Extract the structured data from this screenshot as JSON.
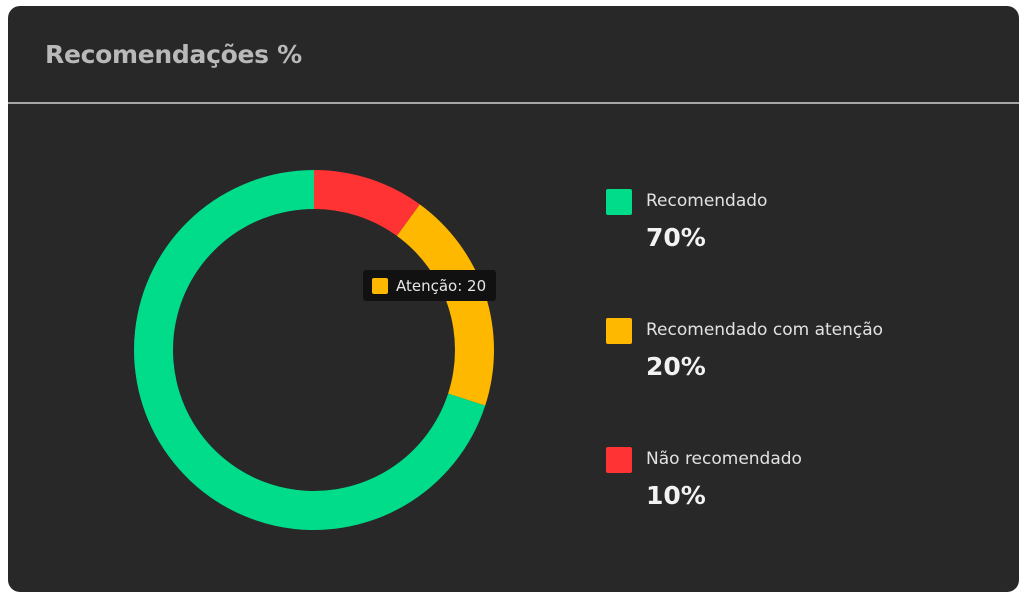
{
  "header": {
    "title": "Recomendações %"
  },
  "colors": {
    "card_background": "#282828",
    "title": "#b9b9b9",
    "divider": "#a6a6a6"
  },
  "chart_data": {
    "type": "pie",
    "variant": "donut",
    "title": "Recomendações %",
    "slices": [
      {
        "label": "Não recomendado",
        "value": 10,
        "display": "10%",
        "color": "#ff3333"
      },
      {
        "label": "Recomendado com atenção",
        "value": 20,
        "display": "20%",
        "color": "#ffb800"
      },
      {
        "label": "Recomendado",
        "value": 70,
        "display": "70%",
        "color": "#00dc8a"
      }
    ],
    "legend": {
      "placement": "right",
      "items": [
        {
          "label": "Recomendado",
          "display": "70%",
          "color": "#00dc8a"
        },
        {
          "label": "Recomendado com atenção",
          "display": "20%",
          "color": "#ffb800"
        },
        {
          "label": "Não recomendado",
          "display": "10%",
          "color": "#ff3333"
        }
      ]
    },
    "tooltip": {
      "text": "Atenção: 20",
      "color": "#ffb800"
    }
  }
}
